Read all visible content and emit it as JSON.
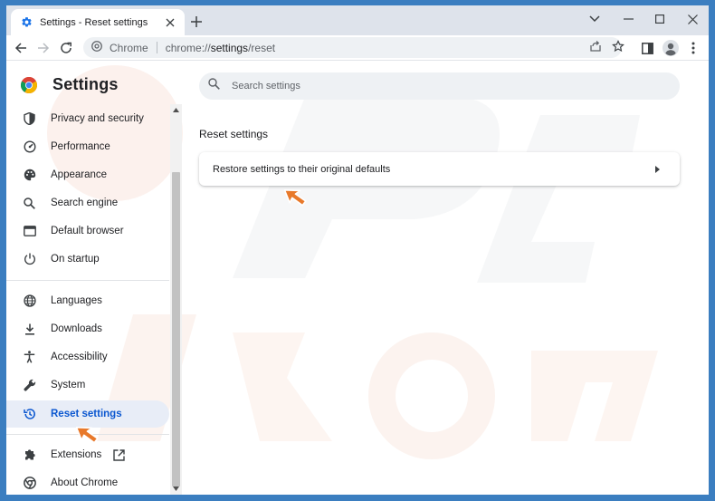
{
  "tab": {
    "title": "Settings - Reset settings"
  },
  "omnibox": {
    "site_label": "Chrome",
    "url_scheme": "chrome://",
    "url_host": "settings",
    "url_path": "/reset"
  },
  "page": {
    "title": "Settings"
  },
  "search": {
    "placeholder": "Search settings"
  },
  "sidebar": {
    "items": [
      {
        "label": "Privacy and security",
        "icon": "shield-icon"
      },
      {
        "label": "Performance",
        "icon": "speedometer-icon"
      },
      {
        "label": "Appearance",
        "icon": "palette-icon"
      },
      {
        "label": "Search engine",
        "icon": "search-icon"
      },
      {
        "label": "Default browser",
        "icon": "browser-window-icon"
      },
      {
        "label": "On startup",
        "icon": "power-icon"
      },
      {
        "label": "Languages",
        "icon": "globe-icon"
      },
      {
        "label": "Downloads",
        "icon": "download-icon"
      },
      {
        "label": "Accessibility",
        "icon": "accessibility-icon"
      },
      {
        "label": "System",
        "icon": "wrench-icon"
      },
      {
        "label": "Reset settings",
        "icon": "history-icon"
      },
      {
        "label": "Extensions",
        "icon": "puzzle-icon"
      },
      {
        "label": "About Chrome",
        "icon": "chrome-icon"
      }
    ],
    "active": "Reset settings"
  },
  "main": {
    "section_title": "Reset settings",
    "rows": [
      {
        "label": "Restore settings to their original defaults"
      }
    ]
  },
  "colors": {
    "accent": "#0b57d0",
    "active_bg": "#e8edf7",
    "tabstrip": "#dee3eb",
    "pointer": "#e8792b"
  }
}
